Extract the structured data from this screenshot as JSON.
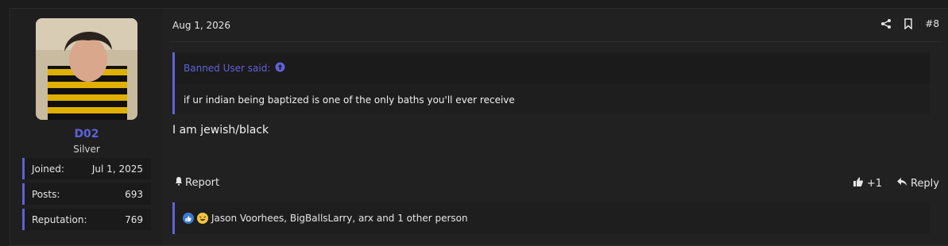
{
  "post": {
    "date": "Aug 1, 2026",
    "number": "#8",
    "user": {
      "name": "D02",
      "title": "Silver",
      "stats": [
        {
          "label": "Joined:",
          "value": "Jul 1, 2025"
        },
        {
          "label": "Posts:",
          "value": "693"
        },
        {
          "label": "Reputation:",
          "value": "769"
        }
      ]
    },
    "quote": {
      "author_line": "Banned User said:",
      "text": "if ur indian being baptized is one of the only baths you'll ever receive"
    },
    "message": "I am jewish/black",
    "actions": {
      "report": "Report",
      "like_count": "+1",
      "reply": "Reply"
    },
    "reactions": {
      "text": "Jason Voorhees, BigBallsLarry, arx and 1 other person"
    }
  },
  "colors": {
    "accent": "#5f62d8",
    "like_icon": "#3a7bd5",
    "laugh_icon": "#f4c542"
  },
  "icons": [
    "share-icon",
    "bookmark-icon",
    "arrow-up-circle-icon",
    "bell-icon",
    "thumbs-up-icon",
    "reply-icon",
    "like-reaction-icon",
    "laugh-reaction-icon"
  ]
}
